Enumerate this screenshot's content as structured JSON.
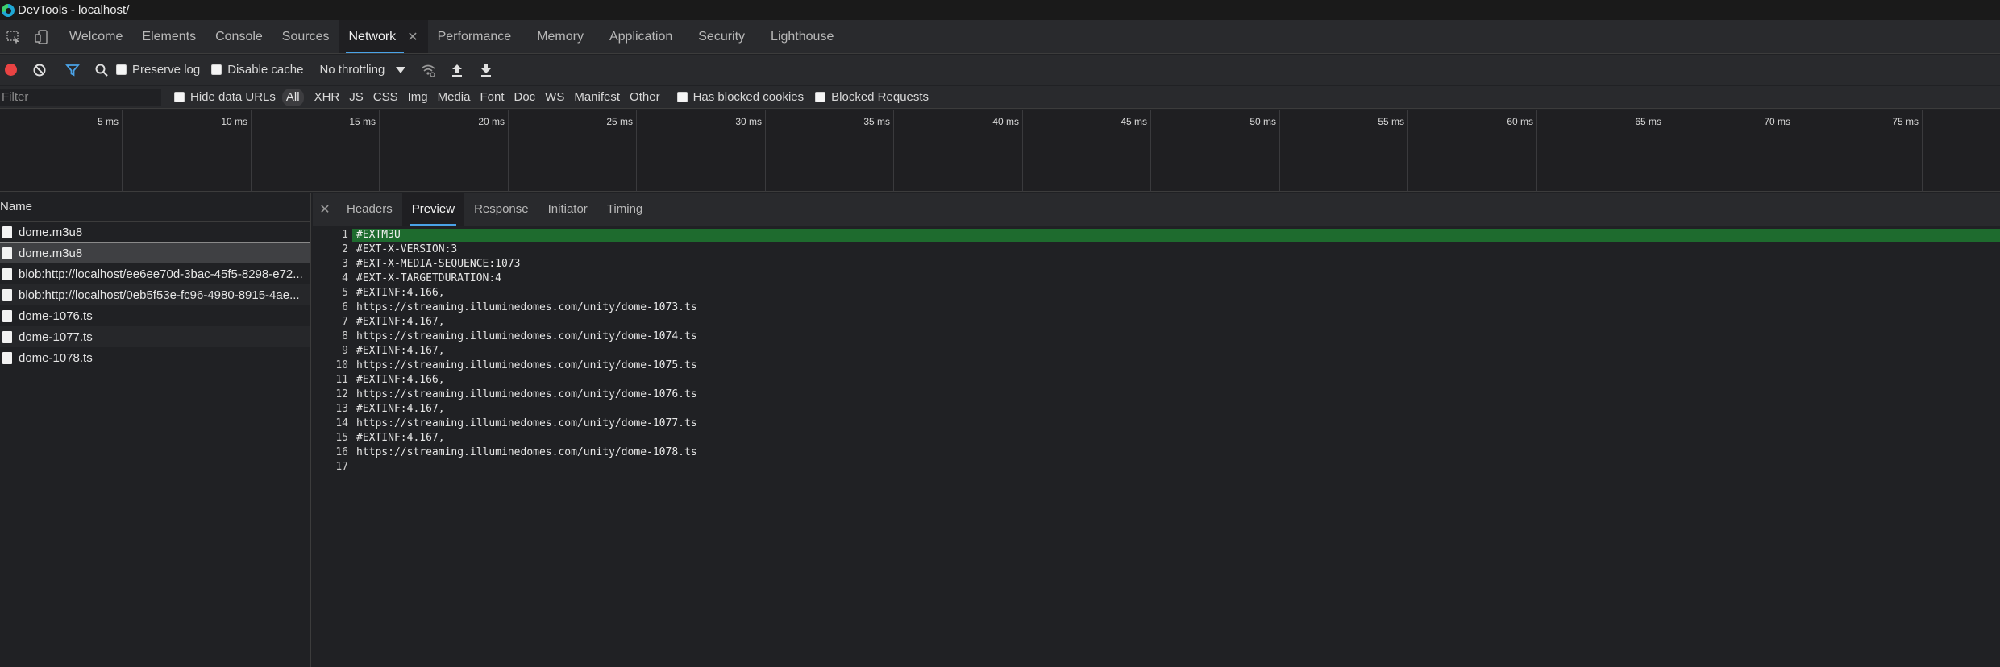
{
  "window": {
    "title": "DevTools - localhost/"
  },
  "main_tabs": [
    {
      "label": "Welcome"
    },
    {
      "label": "Elements"
    },
    {
      "label": "Console"
    },
    {
      "label": "Sources"
    },
    {
      "label": "Network",
      "active": true
    },
    {
      "label": "Performance"
    },
    {
      "label": "Memory"
    },
    {
      "label": "Application"
    },
    {
      "label": "Security"
    },
    {
      "label": "Lighthouse"
    }
  ],
  "toolbar": {
    "preserve_log_label": "Preserve log",
    "disable_cache_label": "Disable cache",
    "throttling_value": "No throttling",
    "record_color": "#e94343"
  },
  "filter_bar": {
    "filter_placeholder": "Filter",
    "hide_data_urls_label": "Hide data URLs",
    "types": [
      "All",
      "XHR",
      "JS",
      "CSS",
      "Img",
      "Media",
      "Font",
      "Doc",
      "WS",
      "Manifest",
      "Other"
    ],
    "active_type": "All",
    "has_blocked_cookies_label": "Has blocked cookies",
    "blocked_requests_label": "Blocked Requests"
  },
  "overview": {
    "ticks": [
      "5 ms",
      "10 ms",
      "15 ms",
      "20 ms",
      "25 ms",
      "30 ms",
      "35 ms",
      "40 ms",
      "45 ms",
      "50 ms",
      "55 ms",
      "60 ms",
      "65 ms",
      "70 ms",
      "75 ms"
    ]
  },
  "request_list": {
    "header": "Name",
    "rows": [
      {
        "name": "dome.m3u8"
      },
      {
        "name": "dome.m3u8",
        "selected": true
      },
      {
        "name": "blob:http://localhost/ee6ee70d-3bac-45f5-8298-e72..."
      },
      {
        "name": "blob:http://localhost/0eb5f53e-fc96-4980-8915-4ae..."
      },
      {
        "name": "dome-1076.ts"
      },
      {
        "name": "dome-1077.ts"
      },
      {
        "name": "dome-1078.ts"
      }
    ]
  },
  "detail": {
    "tabs": [
      "Headers",
      "Preview",
      "Response",
      "Initiator",
      "Timing"
    ],
    "active_tab": "Preview",
    "highlight_color": "#1e6b2e",
    "lines": [
      "#EXTM3U",
      "#EXT-X-VERSION:3",
      "#EXT-X-MEDIA-SEQUENCE:1073",
      "#EXT-X-TARGETDURATION:4",
      "#EXTINF:4.166,",
      "https://streaming.illuminedomes.com/unity/dome-1073.ts",
      "#EXTINF:4.167,",
      "https://streaming.illuminedomes.com/unity/dome-1074.ts",
      "#EXTINF:4.167,",
      "https://streaming.illuminedomes.com/unity/dome-1075.ts",
      "#EXTINF:4.166,",
      "https://streaming.illuminedomes.com/unity/dome-1076.ts",
      "#EXTINF:4.167,",
      "https://streaming.illuminedomes.com/unity/dome-1077.ts",
      "#EXTINF:4.167,",
      "https://streaming.illuminedomes.com/unity/dome-1078.ts",
      ""
    ]
  }
}
